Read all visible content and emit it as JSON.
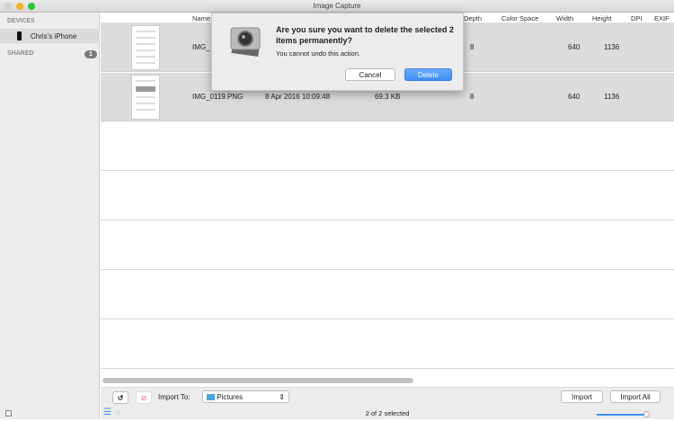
{
  "window": {
    "title": "Image Capture"
  },
  "sidebar": {
    "devices_header": "DEVICES",
    "device": "Chris's iPhone",
    "shared_header": "SHARED",
    "shared_count": "1"
  },
  "columns": [
    "Name",
    "Depth",
    "Color Space",
    "Width",
    "Height",
    "DPI",
    "EXIF"
  ],
  "rows": [
    {
      "name": "IMG_",
      "date": "",
      "size": "",
      "depth": "8",
      "width": "640",
      "height": "1136"
    },
    {
      "name": "IMG_0119.PNG",
      "date": "8 Apr 2016 10:09:48",
      "size": "69.3 KB",
      "depth": "8",
      "width": "640",
      "height": "1136"
    }
  ],
  "toolbar": {
    "import_to_label": "Import To:",
    "destination": "Pictures",
    "import": "Import",
    "import_all": "Import All"
  },
  "status": "2 of 2 selected",
  "dialog": {
    "title": "Are you sure you want to delete the selected 2 items permanently?",
    "message": "You cannot undo this action.",
    "cancel": "Cancel",
    "delete": "Delete"
  },
  "colors": {
    "accent": "#3f8ef5",
    "selection": "#dcdcdc"
  }
}
